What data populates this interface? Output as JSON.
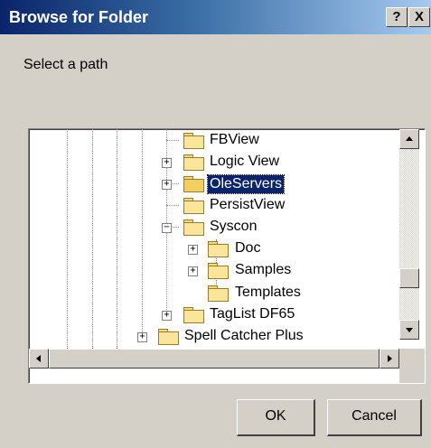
{
  "window": {
    "title": "Browse for Folder",
    "help_label": "?",
    "close_label": "X"
  },
  "prompt": "Select a path",
  "tree": {
    "items": [
      {
        "label": "FBView",
        "expander": "",
        "selected": false
      },
      {
        "label": "Logic View",
        "expander": "+",
        "selected": false
      },
      {
        "label": "OleServers",
        "expander": "+",
        "selected": true
      },
      {
        "label": "PersistView",
        "expander": "",
        "selected": false
      },
      {
        "label": "Syscon",
        "expander": "−",
        "selected": false
      },
      {
        "label": "Doc",
        "expander": "+",
        "selected": false
      },
      {
        "label": "Samples",
        "expander": "+",
        "selected": false
      },
      {
        "label": "Templates",
        "expander": "",
        "selected": false
      },
      {
        "label": "TagList DF65",
        "expander": "+",
        "selected": false
      },
      {
        "label": "Spell Catcher Plus",
        "expander": "+",
        "selected": false
      }
    ]
  },
  "buttons": {
    "ok": "OK",
    "cancel": "Cancel"
  },
  "colors": {
    "dialog_bg": "#d4d0c8",
    "title_gradient_start": "#0a246a",
    "title_gradient_end": "#a6caf0",
    "selection": "#0a246a"
  }
}
